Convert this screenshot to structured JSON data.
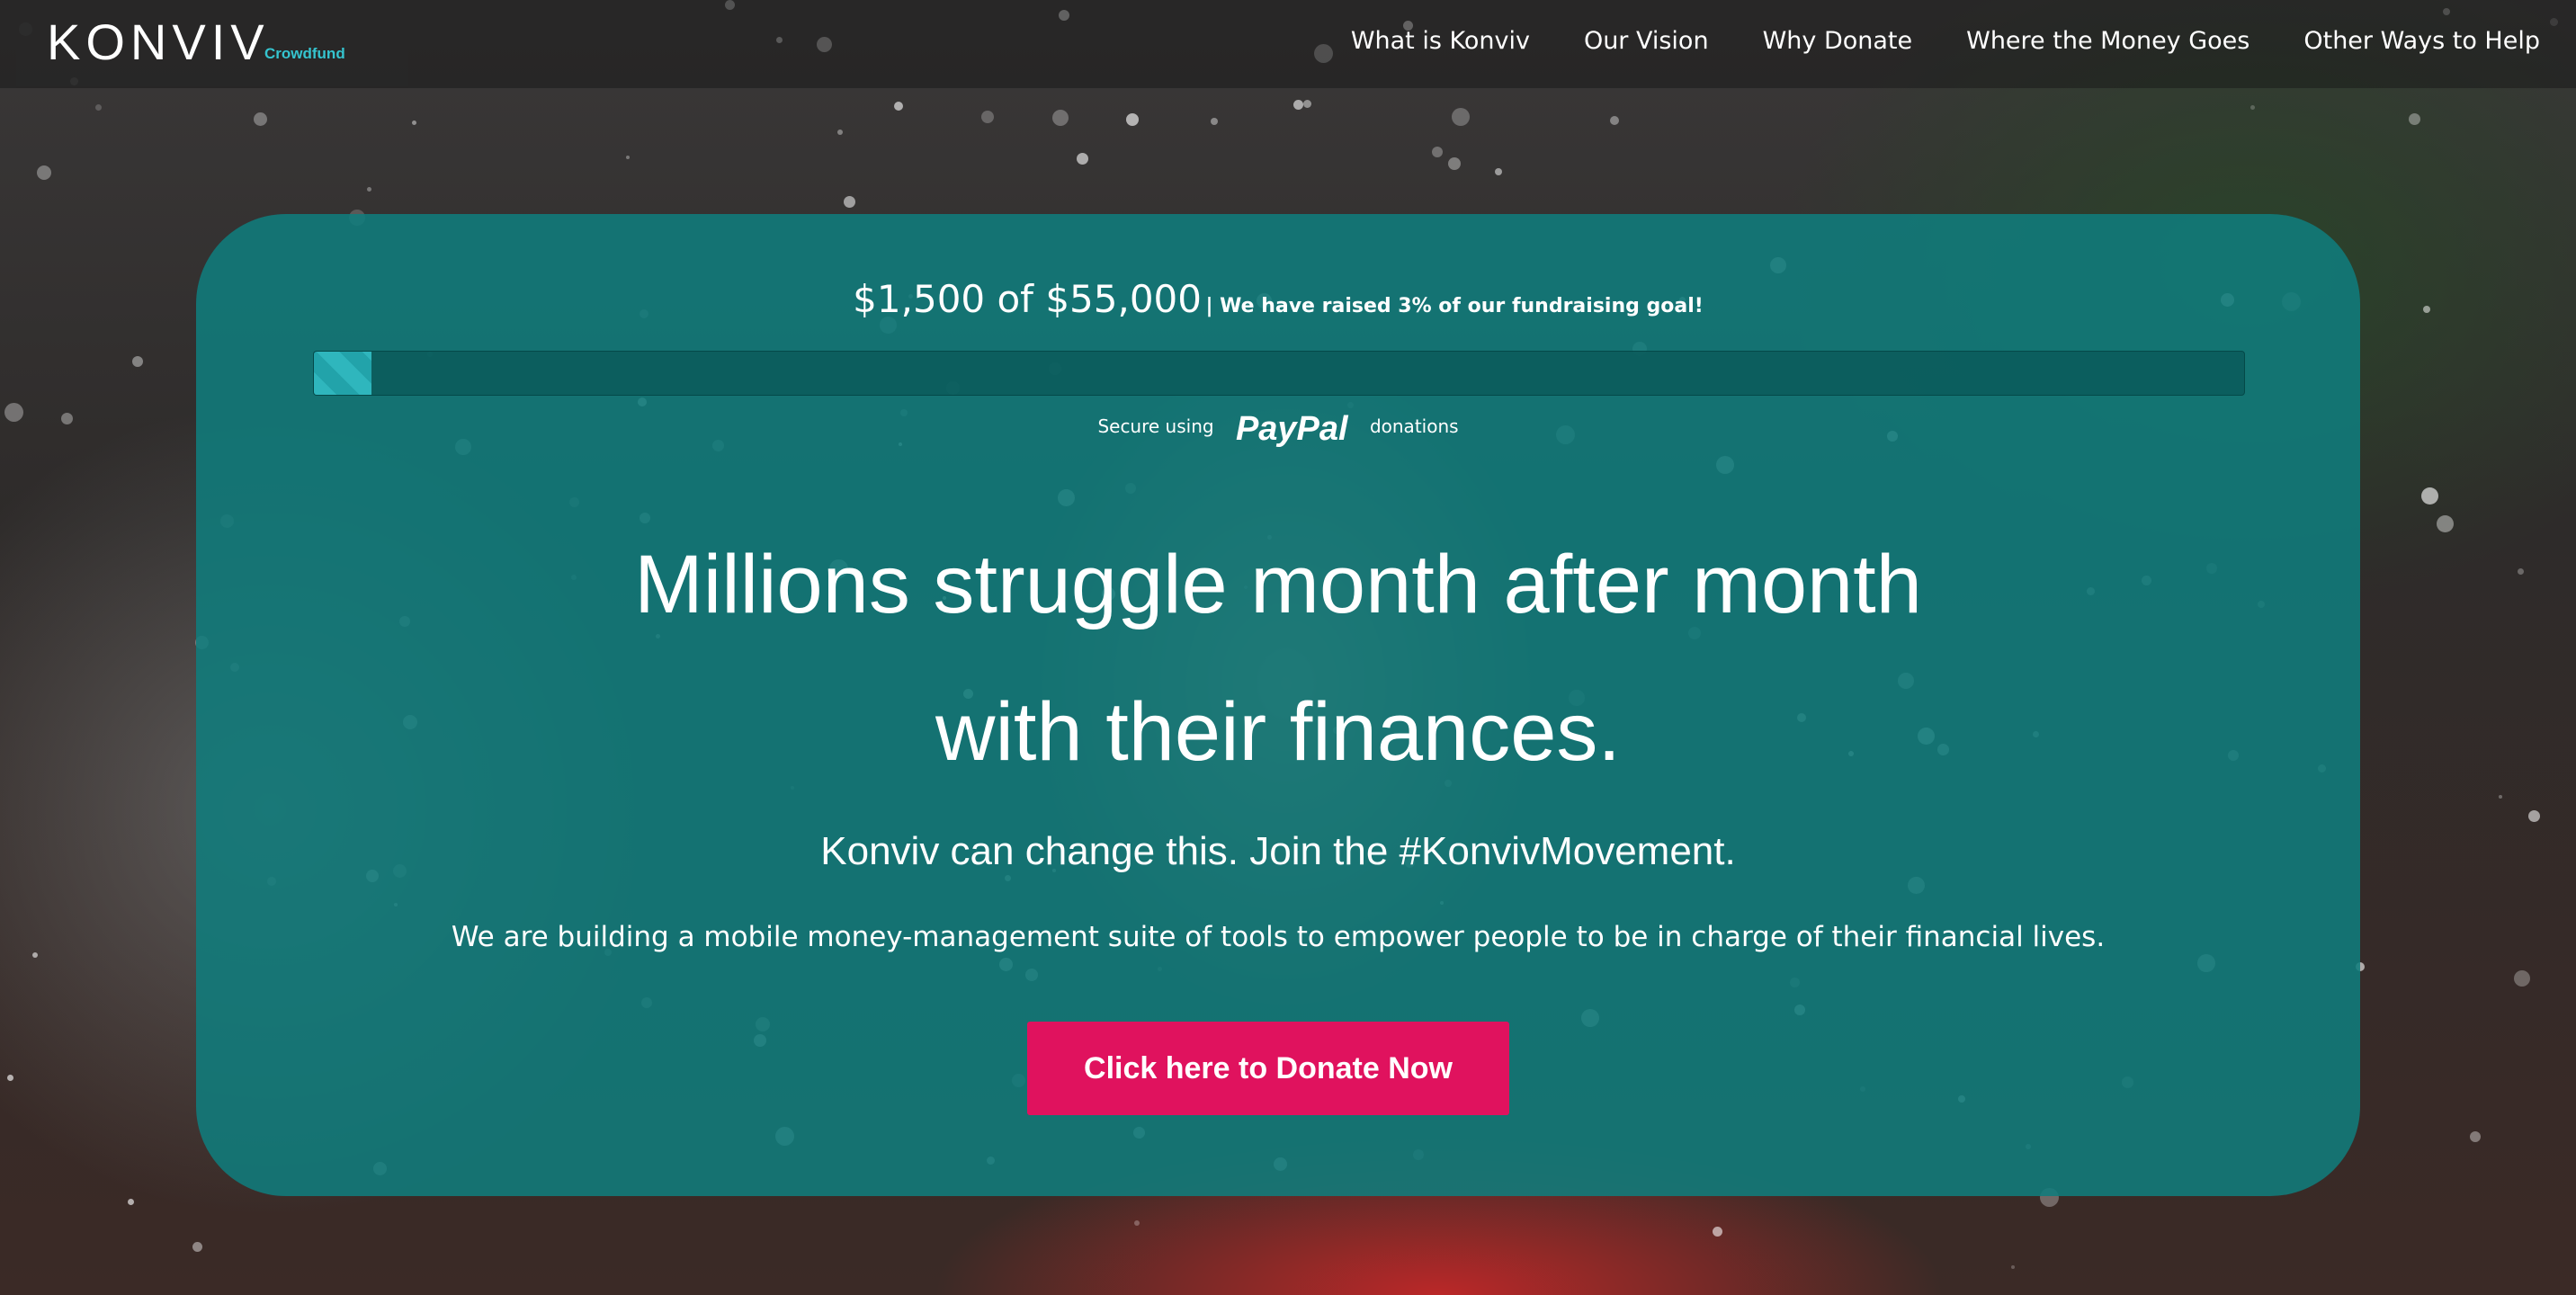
{
  "brand": {
    "name": "KONVIV",
    "sub": "Crowdfund"
  },
  "nav": {
    "items": [
      "What is Konviv",
      "Our Vision",
      "Why Donate",
      "Where the Money Goes",
      "Other Ways to Help"
    ]
  },
  "fundraising": {
    "amount_text": "$1,500 of $55,000",
    "note": "| We have raised 3% of our fundraising goal!",
    "progress_percent": 3
  },
  "secure": {
    "prefix": "Secure using",
    "brand": "PayPal",
    "suffix": "donations"
  },
  "hero": {
    "headline_line1": "Millions struggle month after month",
    "headline_line2": "with their finances.",
    "subhead": "Konviv can change this. Join the #KonvivMovement.",
    "body": "We are building a mobile money-management suite of tools to empower people to be in charge of their financial lives.",
    "cta": "Click here to Donate Now"
  },
  "colors": {
    "accent": "#35c4cf",
    "panel": "#107c7c",
    "cta": "#e0125e"
  }
}
